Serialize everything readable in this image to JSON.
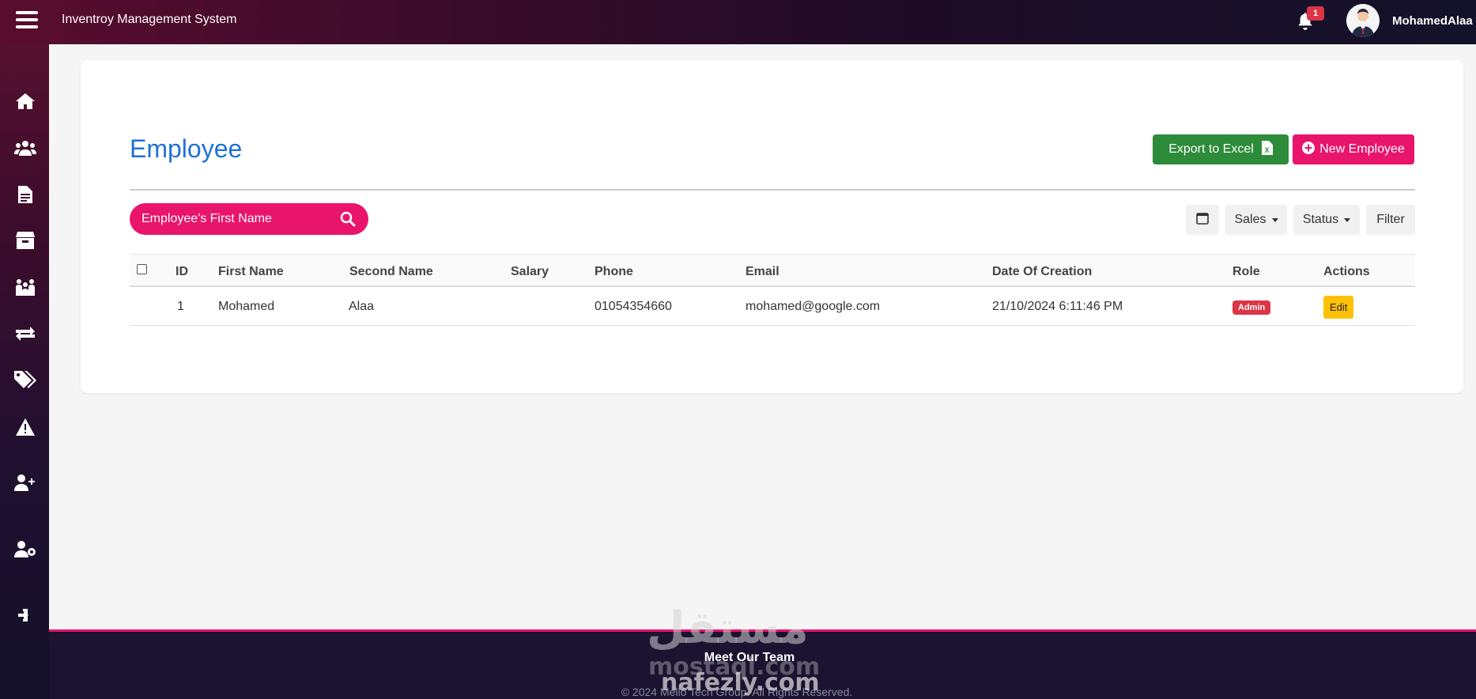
{
  "header": {
    "app_title": "Inventroy Management System",
    "notification_count": "1",
    "username": "MohamedAlaa"
  },
  "sidebar": {
    "items": [
      {
        "icon": "home-icon"
      },
      {
        "icon": "users-icon"
      },
      {
        "icon": "document-icon"
      },
      {
        "icon": "box-icon"
      },
      {
        "icon": "team-icon"
      },
      {
        "icon": "transfer-icon"
      },
      {
        "icon": "tags-icon"
      },
      {
        "icon": "warning-icon"
      },
      {
        "icon": "user-plus-icon"
      },
      {
        "icon": "user-settings-icon"
      },
      {
        "icon": "logout-icon"
      }
    ]
  },
  "main": {
    "title": "Employee",
    "export_label": "Export to Excel",
    "new_label": "New Employee",
    "search_placeholder": "Employee's First Name",
    "filters": {
      "sales": "Sales",
      "status": "Status",
      "filter": "Filter"
    }
  },
  "table": {
    "headers": [
      "ID",
      "First Name",
      "Second Name",
      "Salary",
      "Phone",
      "Email",
      "Date Of Creation",
      "Role",
      "Actions"
    ],
    "rows": [
      {
        "id": "1",
        "first_name": "Mohamed",
        "second_name": "Alaa",
        "salary": "",
        "phone": "01054354660",
        "email": "mohamed@google.com",
        "date_created": "21/10/2024 6:11:46 PM",
        "role": "Admin",
        "action": "Edit"
      }
    ]
  },
  "footer": {
    "link": "Meet Our Team",
    "copyright": "© 2024 Mello Tech Group. All Rights Reserved.",
    "watermark_ar": "مستقل",
    "watermark_en1": "mostaql.com",
    "watermark_en2": "nafezly.com"
  },
  "colors": {
    "accent_pink": "#e9146b",
    "export_green": "#2e8b3a",
    "title_blue": "#1e72d6",
    "admin_red": "#dc3545",
    "edit_yellow": "#ffc107"
  }
}
